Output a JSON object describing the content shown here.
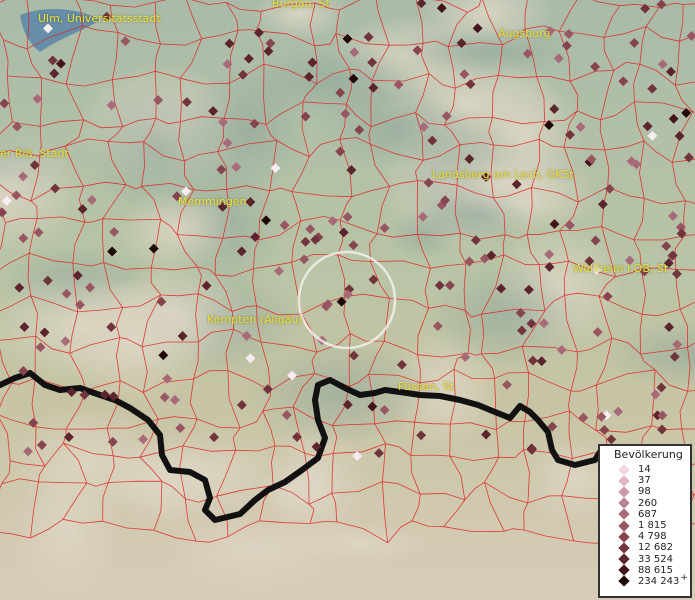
{
  "map": {
    "place_labels": [
      {
        "key": "ulm",
        "text": "Ulm, Universitätsstadt"
      },
      {
        "key": "burgau",
        "text": "Burgau, St"
      },
      {
        "key": "augsburg",
        "text": "Augsburg"
      },
      {
        "key": "biberach",
        "text": "er Riß, Stadt"
      },
      {
        "key": "memmingen",
        "text": "Memmingen"
      },
      {
        "key": "landsberg",
        "text": "Landsberg am Lech, GKSt"
      },
      {
        "key": "weilheim",
        "text": "Weilheim i.OB, St"
      },
      {
        "key": "kempten",
        "text": "Kempten (Allgäu)"
      },
      {
        "key": "fuessen",
        "text": "Füssen, St"
      }
    ],
    "colors": {
      "border_lines": "#e02020",
      "national_border": "#111111",
      "lake": "#5a86a8",
      "label_text": "#e8e23a"
    }
  },
  "legend": {
    "title": "Bevölkerung",
    "items": [
      {
        "label": "14",
        "color": "#f4d4e4"
      },
      {
        "label": "37",
        "color": "#e4b4c4"
      },
      {
        "label": "98",
        "color": "#cc9aa8"
      },
      {
        "label": "260",
        "color": "#b88090"
      },
      {
        "label": "687",
        "color": "#a86a78"
      },
      {
        "label": "1 815",
        "color": "#985662"
      },
      {
        "label": "4 798",
        "color": "#86444e"
      },
      {
        "label": "12 682",
        "color": "#72343c"
      },
      {
        "label": "33 524",
        "color": "#5c242c"
      },
      {
        "label": "88 615",
        "color": "#44141c"
      },
      {
        "label": "234 243",
        "color": "#200808",
        "plus": "+"
      }
    ]
  }
}
